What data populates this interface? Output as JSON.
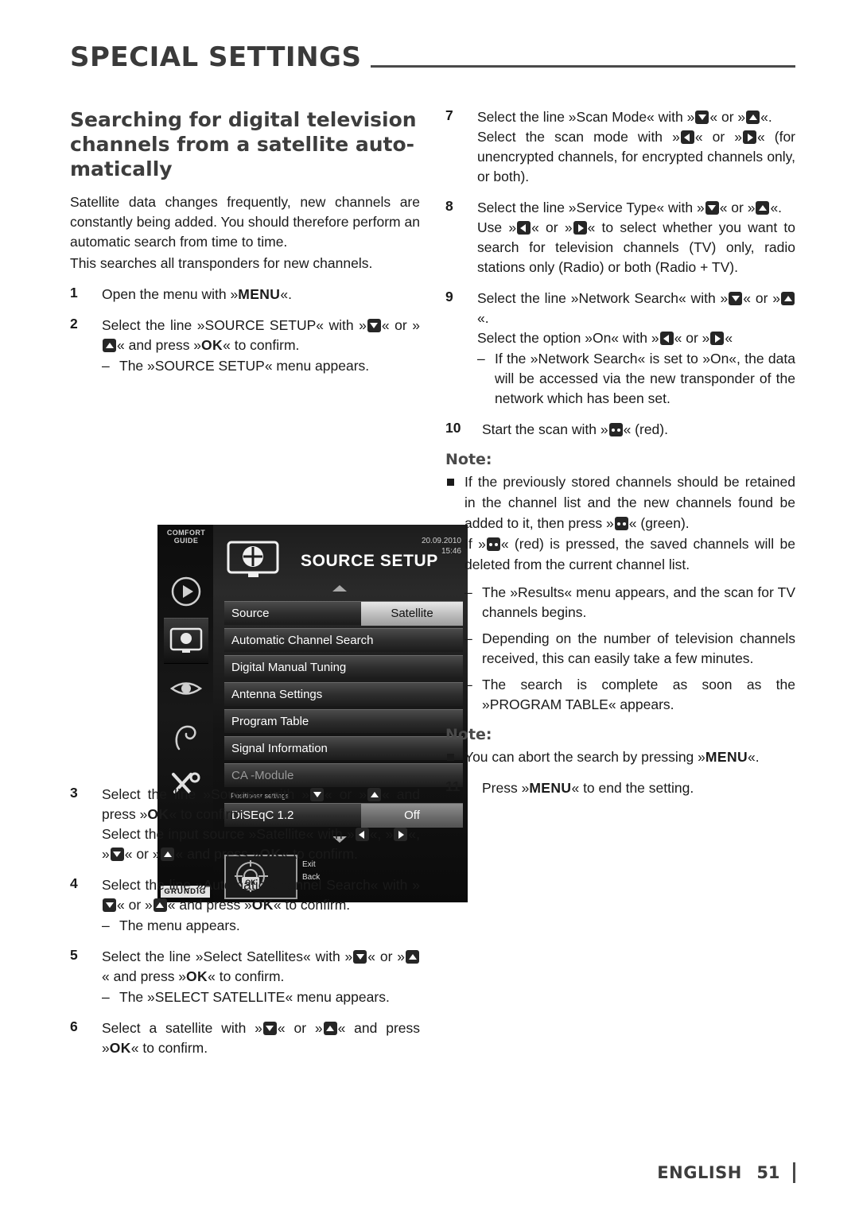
{
  "header": {
    "title": "SPECIAL SETTINGS"
  },
  "left": {
    "section_title": "Searching for digital television channels from a satellite auto­matically",
    "intro1": "Satellite data changes frequently, new chan­nels are constantly being added. You should therefore perform an automatic search from time to time.",
    "intro2": "This searches all transponders for new channels.",
    "steps": {
      "s1": {
        "num": "1",
        "pre": "Open the menu with »",
        "key": "MENU",
        "post": "«."
      },
      "s2": {
        "num": "2",
        "l1a": "Select the line »SOURCE SETUP« with »",
        "l1b": "« or »",
        "l1c": "« and press »",
        "l1d": "OK",
        "l1e": "« to confirm.",
        "sub": "The »SOURCE SETUP« menu appears."
      },
      "s3": {
        "num": "3",
        "t1a": "Select the line »Source« with »",
        "t1b": "« or »",
        "t1c": "« and press »",
        "t1d": "OK",
        "t1e": "« to confirm.",
        "t2a": "Select the input source »Satellite« with »",
        "t2b": "«, »",
        "t2c": "«, »",
        "t2d": "« or »",
        "t2e": "« and press »",
        "t2f": "OK",
        "t2g": "« to con­firm."
      },
      "s4": {
        "num": "4",
        "t1a": "Select the line »Automatic Channel Search« with »",
        "t1b": "« or »",
        "t1c": "« and press »",
        "t1d": "OK",
        "t1e": "« to con­firm.",
        "sub": "The menu appears."
      },
      "s5": {
        "num": "5",
        "t1a": "Select the line »Select Satellites« with »",
        "t1b": "« or »",
        "t1c": "« and press »",
        "t1d": "OK",
        "t1e": "« to confirm.",
        "sub": "The »SELECT SATELLITE« menu appears."
      },
      "s6": {
        "num": "6",
        "t1a": "Select a satellite with »",
        "t1b": "« or »",
        "t1c": "« and press »",
        "t1d": "OK",
        "t1e": "« to confirm."
      }
    }
  },
  "right": {
    "steps": {
      "s7": {
        "num": "7",
        "t1a": "Select the line »Scan Mode« with »",
        "t1b": "« or »",
        "t1c": "«.",
        "t2a": "Select the scan mode with »",
        "t2b": "« or »",
        "t2c": "« (for unencrypted channels, for encrypted channels only, or both)."
      },
      "s8": {
        "num": "8",
        "t1a": "Select the line »Service Type« with »",
        "t1b": "« or »",
        "t1c": "«.",
        "t2a": "Use »",
        "t2b": "« or »",
        "t2c": "« to select whether you want to search for television channels (TV) only, radio stations only (Radio) or both (Radio + TV)."
      },
      "s9": {
        "num": "9",
        "t1a": "Select the line »Network Search« with »",
        "t1b": "« or »",
        "t1c": "«.",
        "t2a": "Select the option »On« with »",
        "t2b": "« or »",
        "t2c": "«",
        "sub": "If the »Network Search« is set to »On«, the data will be accessed via the new transponder of the network which has been set."
      },
      "s10": {
        "num": "10",
        "t1a": "Start the scan with »",
        "t1b": "« (red)."
      },
      "s11": {
        "num": "11",
        "t1a": "Press »",
        "t1b": "MENU",
        "t1c": "« to end the setting."
      }
    },
    "note1_title": "Note:",
    "note1_b1a": "If the previously stored channels should be retained in the channel list and the new channels found be added to it, then press »",
    "note1_b1b": "« (green).",
    "note1_b2a": "If »",
    "note1_b2b": "« (red) is pressed, the saved channels will be deleted from the current channel list.",
    "note1_sub1": "The »Results« menu appears, and the scan for TV channels begins.",
    "note1_sub2": "Depending on the number of television channels received, this can easily take a few minutes.",
    "note1_sub3": "The search is complete as soon as the »PROGRAM TABLE« appears.",
    "note2_title": "Note:",
    "note2_b1a": "You can abort the search by pressing »",
    "note2_b1b": "MENU",
    "note2_b1c": "«."
  },
  "tv": {
    "comfort_line1": "COMFORT",
    "comfort_line2": "GUIDE",
    "title": "SOURCE SETUP",
    "date": "20.09.2010",
    "time": "15:46",
    "rows": [
      {
        "label": "Source",
        "value": "Satellite"
      },
      {
        "label": "Automatic Channel Search",
        "value": ""
      },
      {
        "label": "Digital Manual Tuning",
        "value": ""
      },
      {
        "label": "Antenna Settings",
        "value": ""
      },
      {
        "label": "Program Table",
        "value": ""
      },
      {
        "label": "Signal Information",
        "value": ""
      },
      {
        "label": "CA -Module",
        "value": ""
      }
    ],
    "positioner_label": "Positioner settings",
    "diseqc_label": "DiSEqC 1.2",
    "diseqc_value": "Off",
    "ok_badge": "OK",
    "foot_exit": "Exit",
    "foot_back": "Back",
    "brand": "GRUNDIG"
  },
  "footer": {
    "language": "ENGLISH",
    "page": "51"
  },
  "colors": {
    "ink": "#1a1a1a",
    "heading": "#3d3d3d",
    "rule": "#4a4a4a"
  }
}
